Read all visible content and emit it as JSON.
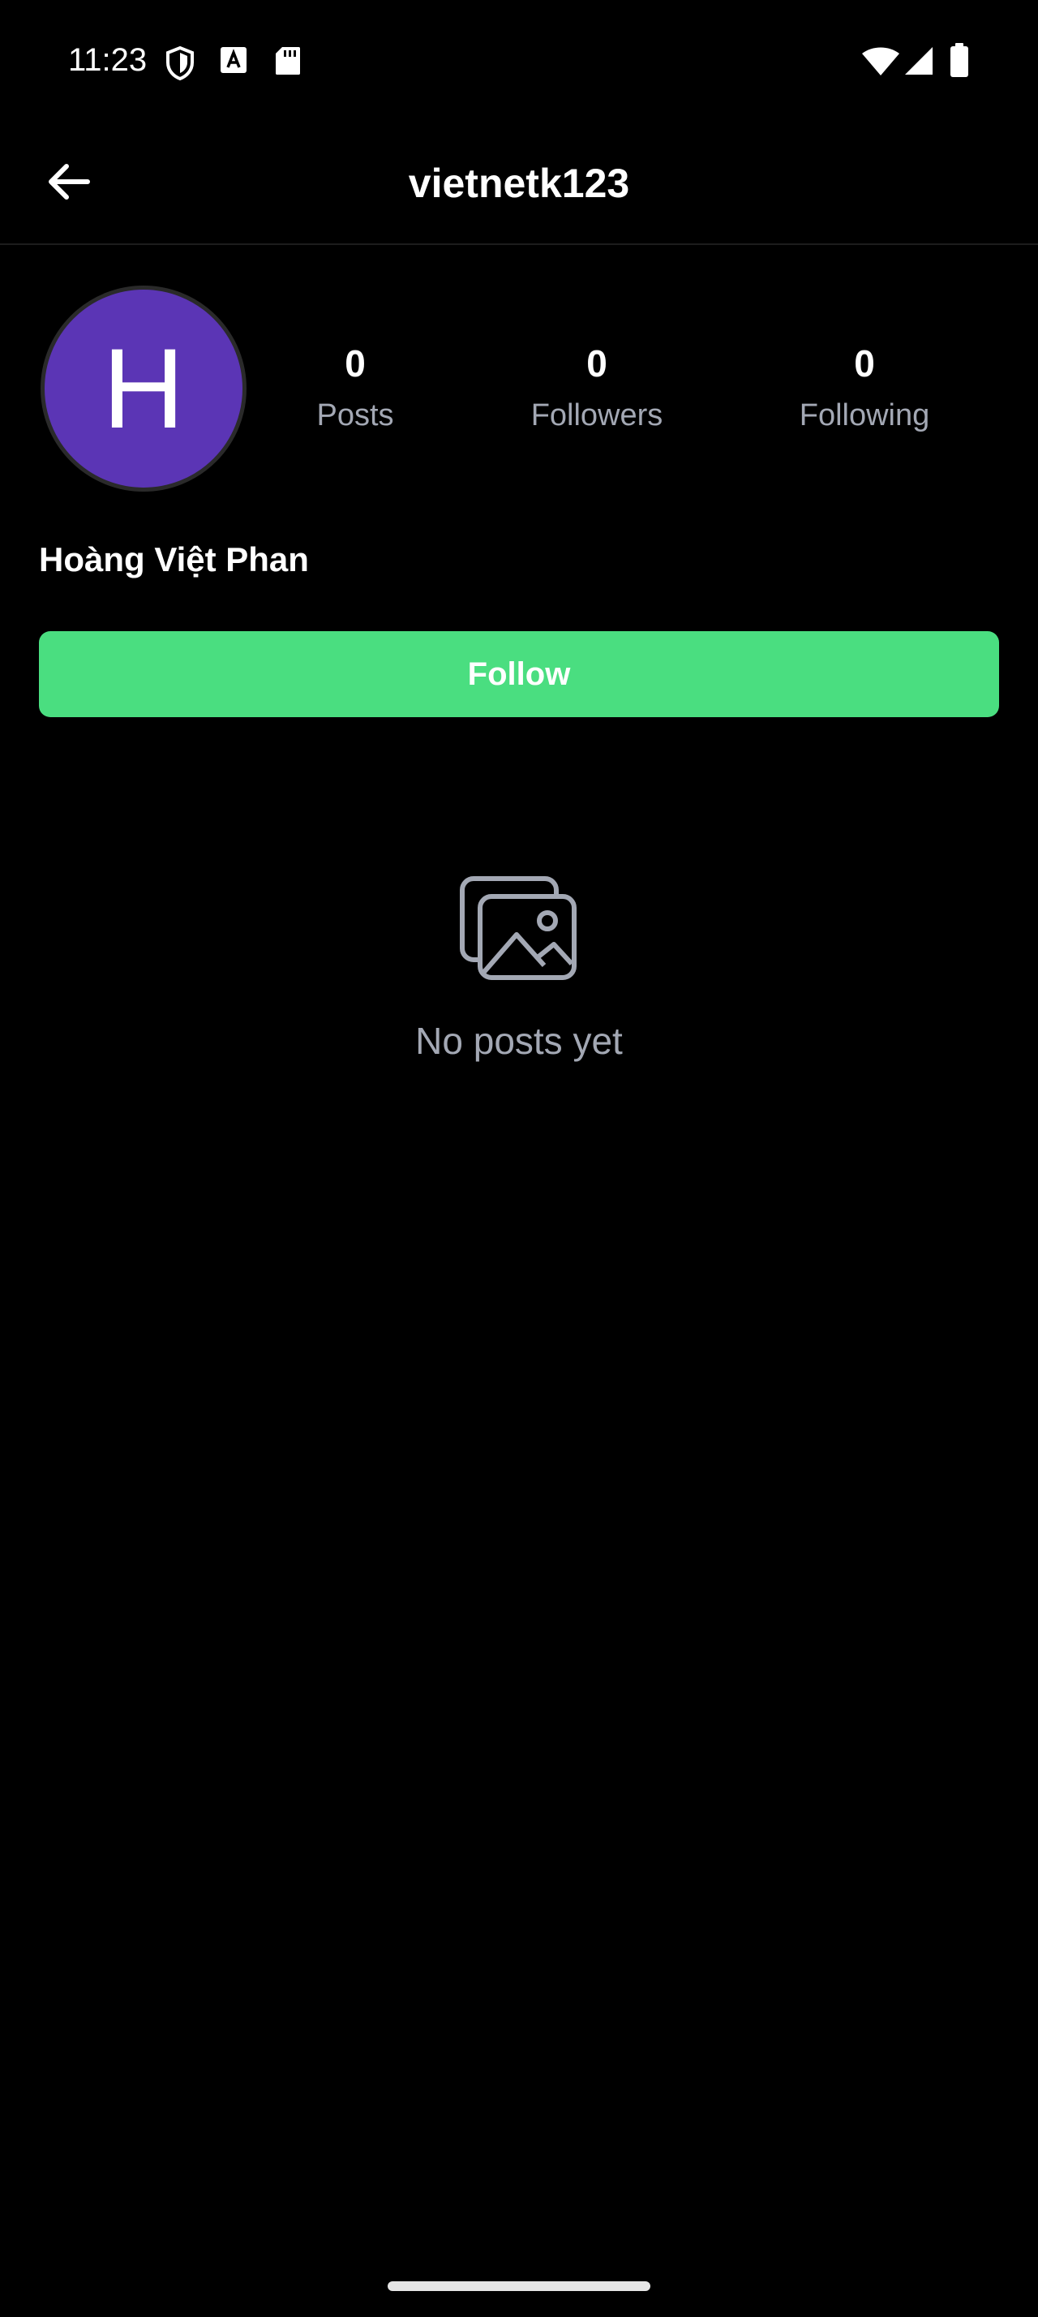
{
  "status_bar": {
    "time": "11:23",
    "icons_left": [
      "shield-icon",
      "font-a-icon",
      "sd-card-icon"
    ],
    "icons_right": [
      "wifi-icon",
      "cell-signal-icon",
      "battery-icon"
    ]
  },
  "header": {
    "title": "vietnetk123",
    "back_icon": "arrow-left-icon"
  },
  "profile": {
    "avatar_initial": "H",
    "avatar_color": "#5b35b5",
    "display_name": "Hoàng Việt Phan",
    "stats": {
      "posts": {
        "value": "0",
        "label": "Posts"
      },
      "followers": {
        "value": "0",
        "label": "Followers"
      },
      "following": {
        "value": "0",
        "label": "Following"
      }
    },
    "follow_button": {
      "label": "Follow",
      "color": "#4ade80"
    }
  },
  "empty_state": {
    "icon": "images-icon",
    "text": "No posts yet"
  }
}
